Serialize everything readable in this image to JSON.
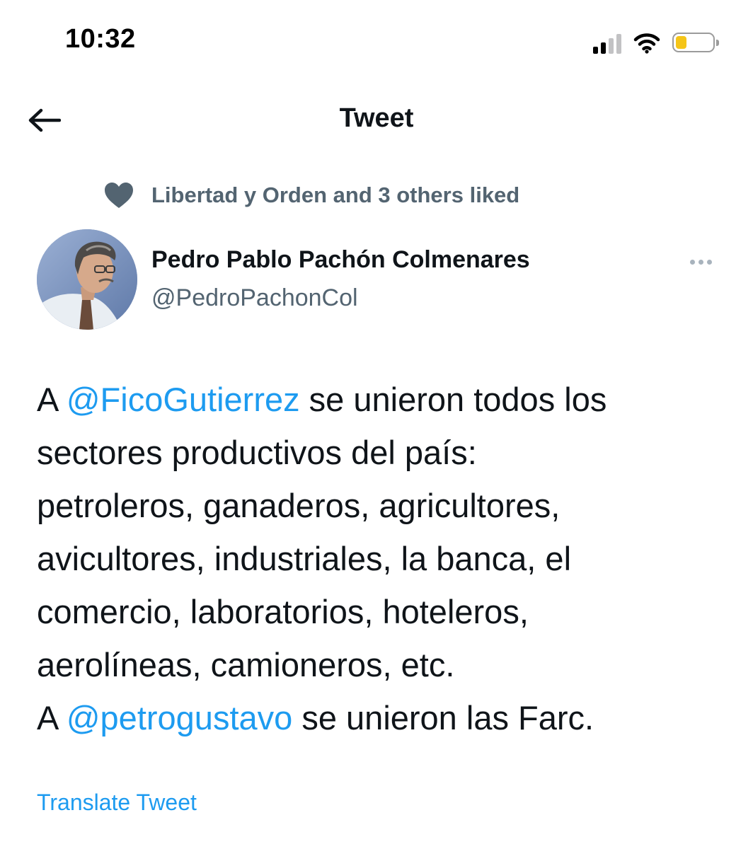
{
  "status_bar": {
    "time": "10:32",
    "battery_level": 0.26,
    "signal_bars_filled": 2,
    "signal_bars_total": 4,
    "colors": {
      "battery": "#f5c518"
    }
  },
  "header": {
    "title": "Tweet",
    "back_icon": "arrow-left-icon"
  },
  "social_context": {
    "icon": "heart-icon",
    "text": "Libertad y Orden and 3 others liked"
  },
  "author": {
    "name": "Pedro Pablo Pachón Colmenares",
    "handle": "@PedroPachonCol",
    "more_icon": "more-horizontal-icon"
  },
  "tweet": {
    "lines": [
      {
        "pre": "A ",
        "mention": "@FicoGutierrez",
        "post": " se unieron todos los"
      },
      {
        "text": "sectores productivos del país:"
      },
      {
        "text": "petroleros, ganaderos, agricultores,"
      },
      {
        "text": "avicultores, industriales, la banca, el"
      },
      {
        "text": "comercio, laboratorios, hoteleros,"
      },
      {
        "text": "aerolíneas, camioneros, etc."
      },
      {
        "pre": "A ",
        "mention": "@petrogustavo",
        "post": " se unieron las Farc."
      }
    ],
    "translate_label": "Translate Tweet"
  },
  "colors": {
    "link": "#1d9bf0",
    "secondary_text": "#536471",
    "primary_text": "#0f1419"
  }
}
